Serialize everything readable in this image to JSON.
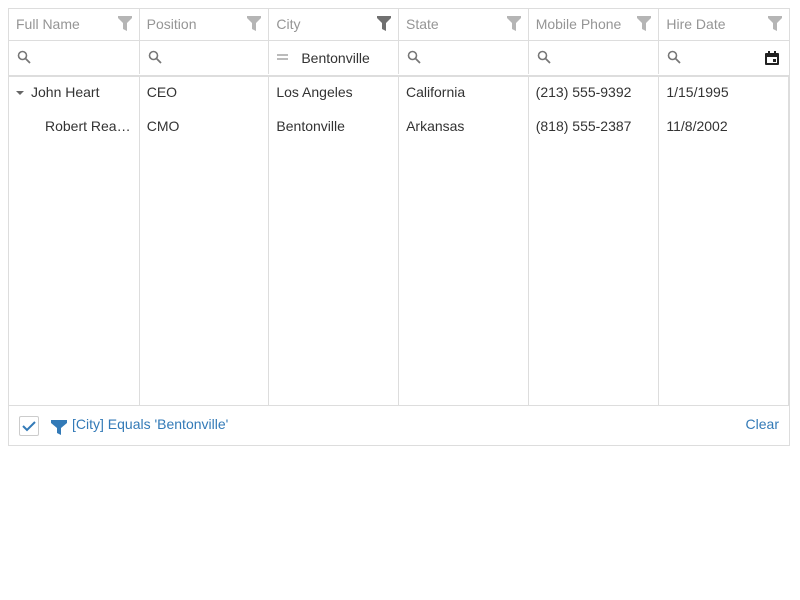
{
  "columns": [
    {
      "label": "Full Name"
    },
    {
      "label": "Position"
    },
    {
      "label": "City"
    },
    {
      "label": "State"
    },
    {
      "label": "Mobile Phone"
    },
    {
      "label": "Hire Date"
    }
  ],
  "filter_row": {
    "city_value": "Bentonville",
    "city_operation_icon": "equals-icon",
    "hire_date_icon": "calendar-icon"
  },
  "rows": [
    {
      "full_name": "John Heart",
      "position": "CEO",
      "city": "Los Angeles",
      "state": "California",
      "mobile_phone": "(213) 555-9392",
      "hire_date": "1/15/1995",
      "expanded": true
    },
    {
      "full_name": "Robert Reagan",
      "position": "CMO",
      "city": "Bentonville",
      "state": "Arkansas",
      "mobile_phone": "(818) 555-2387",
      "hire_date": "11/8/2002"
    }
  ],
  "filter_panel": {
    "text": "[City] Equals 'Bentonville'",
    "clear_label": "Clear",
    "enabled": true
  },
  "colors": {
    "accent": "#337ab7",
    "header_text": "#959595",
    "filter_icon_inactive": "#b5b5b5",
    "filter_icon_active": "#707070",
    "border": "#dddddd"
  }
}
